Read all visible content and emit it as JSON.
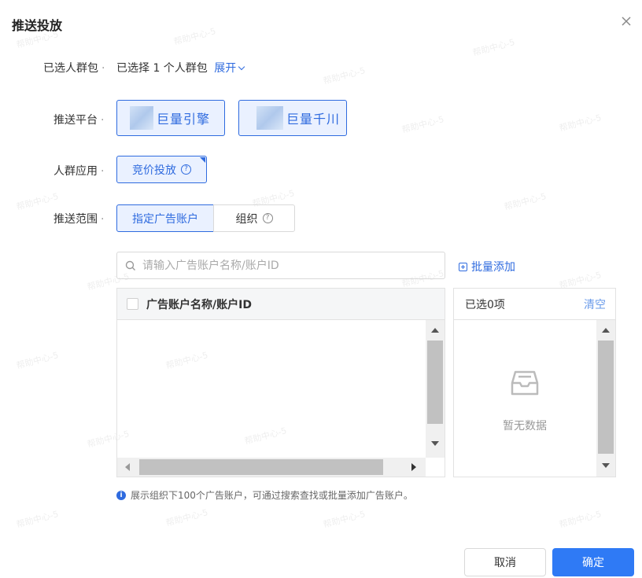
{
  "dialog": {
    "title": "推送投放",
    "close_icon": "close-icon"
  },
  "watermark": "帮助中心-5",
  "selected_crowd": {
    "label": "已选人群包",
    "value": "已选择 1 个人群包",
    "expand": "展开"
  },
  "platform": {
    "label": "推送平台",
    "options": [
      {
        "name": "巨量引擎"
      },
      {
        "name": "巨量千川"
      }
    ]
  },
  "crowd_app": {
    "label": "人群应用",
    "option": "竞价投放"
  },
  "scope": {
    "label": "推送范围",
    "tabs": [
      "指定广告账户",
      "组织"
    ]
  },
  "search": {
    "placeholder": "请输入广告账户名称/账户ID",
    "batch_add": "批量添加"
  },
  "table": {
    "header": "广告账户名称/账户ID"
  },
  "selected_panel": {
    "count_label": "已选0项",
    "clear": "清空",
    "empty": "暂无数据"
  },
  "hint": "展示组织下100个广告账户，可通过搜索查找或批量添加广告账户。",
  "footer": {
    "cancel": "取消",
    "ok": "确定"
  },
  "colors": {
    "primary": "#2f6bdf",
    "primary_button": "#2f7af5",
    "selected_bg": "#eaf1ff"
  }
}
